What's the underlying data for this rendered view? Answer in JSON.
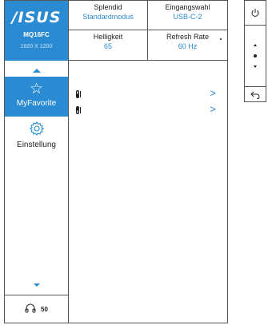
{
  "brand": {
    "logo": "/ISUS",
    "model": "MQ16FC",
    "resolution": "1920 X 1200"
  },
  "menu": [
    {
      "label": "MyFavorite",
      "icon": "star-icon",
      "selected": true
    },
    {
      "label": "Einstellung",
      "icon": "gear-icon",
      "selected": false
    }
  ],
  "status": {
    "icon": "headphones-icon",
    "value": "50"
  },
  "info": {
    "splendid": {
      "title": "Splendid",
      "value": "Standardmodus"
    },
    "input": {
      "title": "Eingangswahl",
      "value": "USB-C-2"
    },
    "brightness": {
      "title": "Helligkeit",
      "value": "65"
    },
    "refresh": {
      "title": "Refresh Rate",
      "value": "60 Hz"
    }
  },
  "favorites": [
    {
      "icon": "shortcut-1-icon",
      "chevron": ">"
    },
    {
      "icon": "shortcut-2-icon",
      "chevron": ">"
    }
  ],
  "colors": {
    "accent": "#2a8ad2",
    "border": "#555555"
  }
}
